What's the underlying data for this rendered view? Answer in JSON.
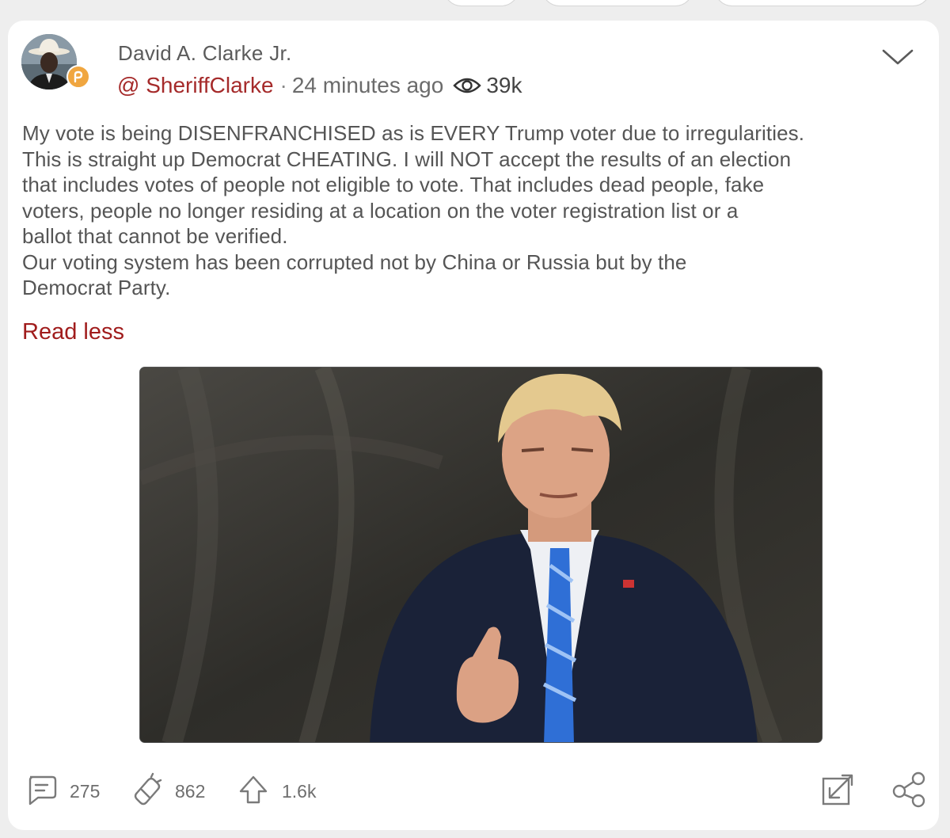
{
  "post": {
    "author_name": "David A. Clarke Jr.",
    "handle": "@ SheriffClarke",
    "separator": "·",
    "timestamp": "24 minutes ago",
    "views": "39k",
    "body": "My vote is being DISENFRANCHISED as is EVERY Trump voter due to irregularities.\nThis is straight up Democrat CHEATING. I will NOT accept the results of an election\nthat includes votes of people not eligible to vote. That includes dead people, fake\nvoters, people no longer residing at a location on the voter registration list or a\nballot that cannot be verified.\nOur voting system has been corrupted not by China or Russia but by the\nDemocrat Party.",
    "read_less_label": "Read less"
  },
  "actions": {
    "comments": "275",
    "echoes": "862",
    "upvotes": "1.6k"
  },
  "icons": {
    "more": "chevron-down-icon",
    "views": "eye-icon",
    "comments": "comment-icon",
    "echoes": "echo-icon",
    "upvotes": "upvote-icon",
    "expand": "expand-icon",
    "share": "share-icon",
    "badge": "parler-badge-icon"
  },
  "colors": {
    "handle": "#a52a2a",
    "read_less": "#a01c1c",
    "badge": "#f0a640",
    "text": "#555555"
  }
}
